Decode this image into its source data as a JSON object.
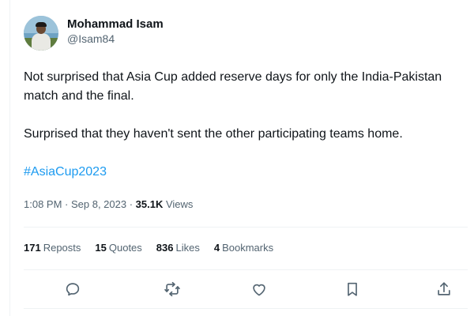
{
  "author": {
    "display_name": "Mohammad Isam",
    "handle": "@Isam84"
  },
  "tweet": {
    "paragraph1": "Not surprised that Asia Cup added reserve days for only the India-Pakistan match and the final.",
    "paragraph2": "Surprised that they haven't sent the other participating teams home.",
    "hashtag": "#AsiaCup2023"
  },
  "meta": {
    "timestamp": "1:08 PM · Sep 8, 2023 · ",
    "views_count": "35.1K",
    "views_label": " Views"
  },
  "stats": {
    "reposts_count": "171",
    "reposts_label": "Reposts",
    "quotes_count": "15",
    "quotes_label": "Quotes",
    "likes_count": "836",
    "likes_label": "Likes",
    "bookmarks_count": "4",
    "bookmarks_label": "Bookmarks"
  },
  "icons": {
    "reply": "reply-icon",
    "repost": "repost-icon",
    "like": "heart-icon",
    "bookmark": "bookmark-icon",
    "share": "share-icon"
  },
  "colors": {
    "text": "#0f1419",
    "secondary": "#536471",
    "link": "#1d9bf0",
    "divider": "#eff3f4"
  }
}
